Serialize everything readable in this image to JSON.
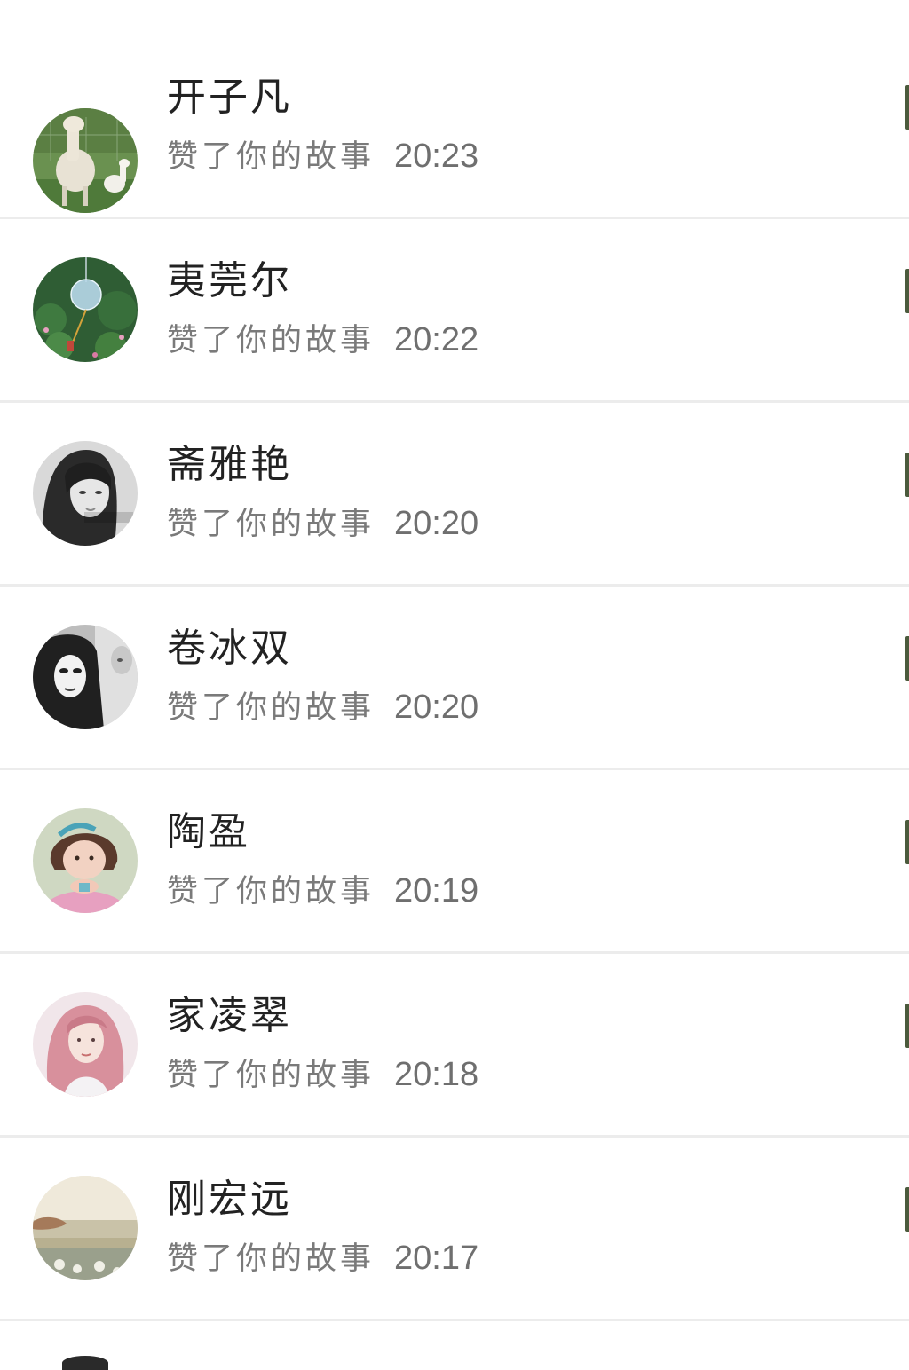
{
  "notifications": [
    {
      "name": "开子凡",
      "action": "赞了你的故事",
      "time": "20:23",
      "avatar_icon": "alpaca-photo-avatar",
      "avatar_colors": [
        "#4f7a3a",
        "#e8e2d4"
      ]
    },
    {
      "name": "夷莞尔",
      "action": "赞了你的故事",
      "time": "20:22",
      "avatar_icon": "wind-chime-photo-avatar",
      "avatar_colors": [
        "#2f5d34",
        "#b8d8ea"
      ]
    },
    {
      "name": "斋雅艳",
      "action": "赞了你的故事",
      "time": "20:20",
      "avatar_icon": "woman-portrait-avatar",
      "avatar_colors": [
        "#3a3a3a",
        "#d9d9d9"
      ]
    },
    {
      "name": "卷冰双",
      "action": "赞了你的故事",
      "time": "20:20",
      "avatar_icon": "mask-portrait-avatar",
      "avatar_colors": [
        "#202020",
        "#c8c8c8"
      ]
    },
    {
      "name": "陶盈",
      "action": "赞了你的故事",
      "time": "20:19",
      "avatar_icon": "child-photo-avatar",
      "avatar_colors": [
        "#cfd8c2",
        "#e7a0c0"
      ]
    },
    {
      "name": "家凌翠",
      "action": "赞了你的故事",
      "time": "20:18",
      "avatar_icon": "pink-hair-portrait-avatar",
      "avatar_colors": [
        "#f1e6ea",
        "#d8909c"
      ]
    },
    {
      "name": "刚宏远",
      "action": "赞了你的故事",
      "time": "20:17",
      "avatar_icon": "sea-landscape-avatar",
      "avatar_colors": [
        "#e7e2d4",
        "#9aa08c"
      ]
    }
  ]
}
